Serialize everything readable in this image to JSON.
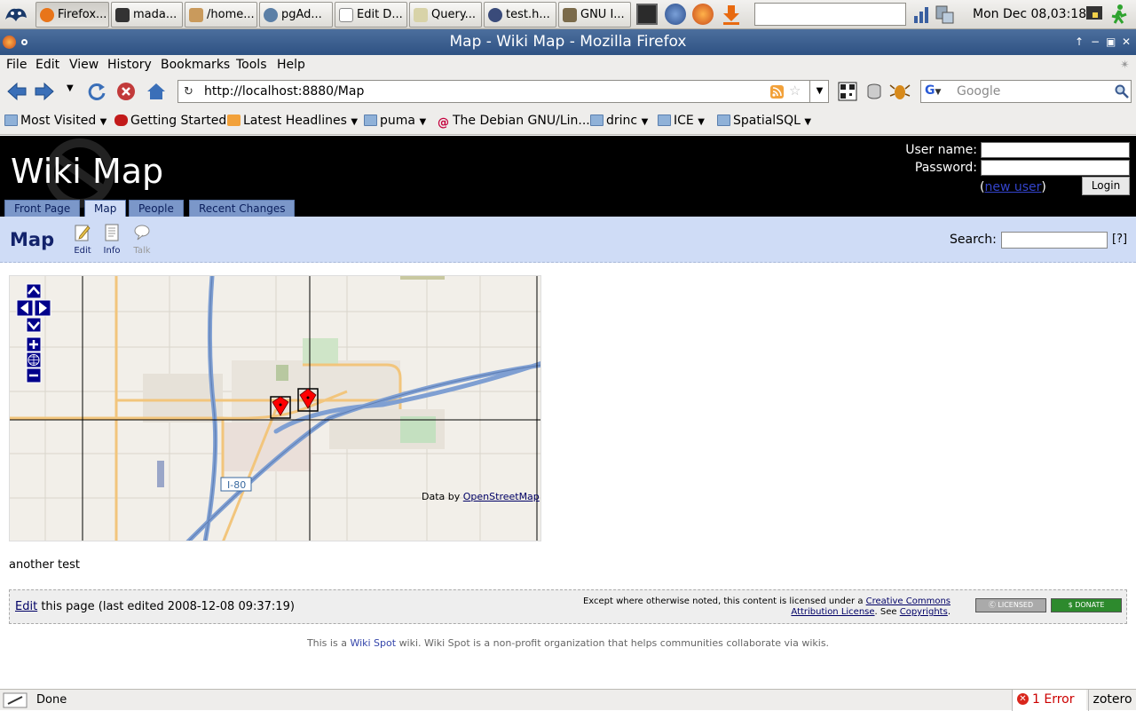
{
  "taskbar": {
    "tasks": [
      "Firefox...",
      "mada...",
      "/home...",
      "pgAd...",
      "Edit D...",
      "Query...",
      "test.h...",
      "GNU I..."
    ],
    "clock": "Mon Dec 08,03:18"
  },
  "window": {
    "title": "Map - Wiki Map - Mozilla Firefox"
  },
  "menubar": {
    "items": [
      {
        "label": "File"
      },
      {
        "label": "Edit"
      },
      {
        "label": "View"
      },
      {
        "label": "History"
      },
      {
        "label": "Bookmarks"
      },
      {
        "label": "Tools"
      },
      {
        "label": "Help"
      }
    ]
  },
  "navbar": {
    "url": "http://localhost:8880/Map",
    "search_placeholder": "Google"
  },
  "bookmarks": {
    "items": [
      {
        "label": "Most Visited"
      },
      {
        "label": "Getting Started"
      },
      {
        "label": "Latest Headlines"
      },
      {
        "label": "puma"
      },
      {
        "label": "The Debian GNU/Lin..."
      },
      {
        "label": "drinc"
      },
      {
        "label": "ICE"
      },
      {
        "label": "SpatialSQL"
      }
    ]
  },
  "wiki": {
    "site_title": "Wiki Map",
    "login": {
      "username_label": "User name:",
      "password_label": "Password:",
      "new_user": "new user",
      "login_button": "Login"
    },
    "tabs": [
      {
        "label": "Front Page"
      },
      {
        "label": "Map",
        "active": true
      },
      {
        "label": "People"
      },
      {
        "label": "Recent Changes"
      }
    ],
    "page_title": "Map",
    "page_actions": [
      {
        "label": "Edit"
      },
      {
        "label": "Info"
      },
      {
        "label": "Talk"
      }
    ],
    "search_label": "Search:",
    "help_link": "[?]",
    "map": {
      "highway_label": "I-80",
      "attribution_prefix": "Data by",
      "attribution_link": "OpenStreetMap"
    },
    "body_text": "another test",
    "footer": {
      "edit_link": "Edit",
      "edit_text": "this page (last edited 2008-12-08 09:37:19)",
      "license_prefix": "Except where otherwise noted, this content is licensed under a",
      "license_link": "Creative Commons Attribution License",
      "see": ". See",
      "copyrights_link": "Copyrights",
      "badge_licensed": "LICENSED",
      "badge_donate": "DONATE"
    },
    "wikispot": {
      "prefix": "This is a",
      "link": "Wiki Spot",
      "suffix": "wiki. Wiki Spot is a non-profit organization that helps communities collaborate via wikis."
    }
  },
  "statusbar": {
    "status": "Done",
    "error": "1 Error",
    "zotero": "zotero"
  },
  "colors": {
    "title_bar": "#2e5283",
    "wiki_header": "#000000",
    "wiki_tab": "#7b97c9",
    "page_bar": "#cfdcf6",
    "map_road": "#7f9fd2",
    "map_arterial": "#f2c57c",
    "marker": "#ff0000"
  }
}
